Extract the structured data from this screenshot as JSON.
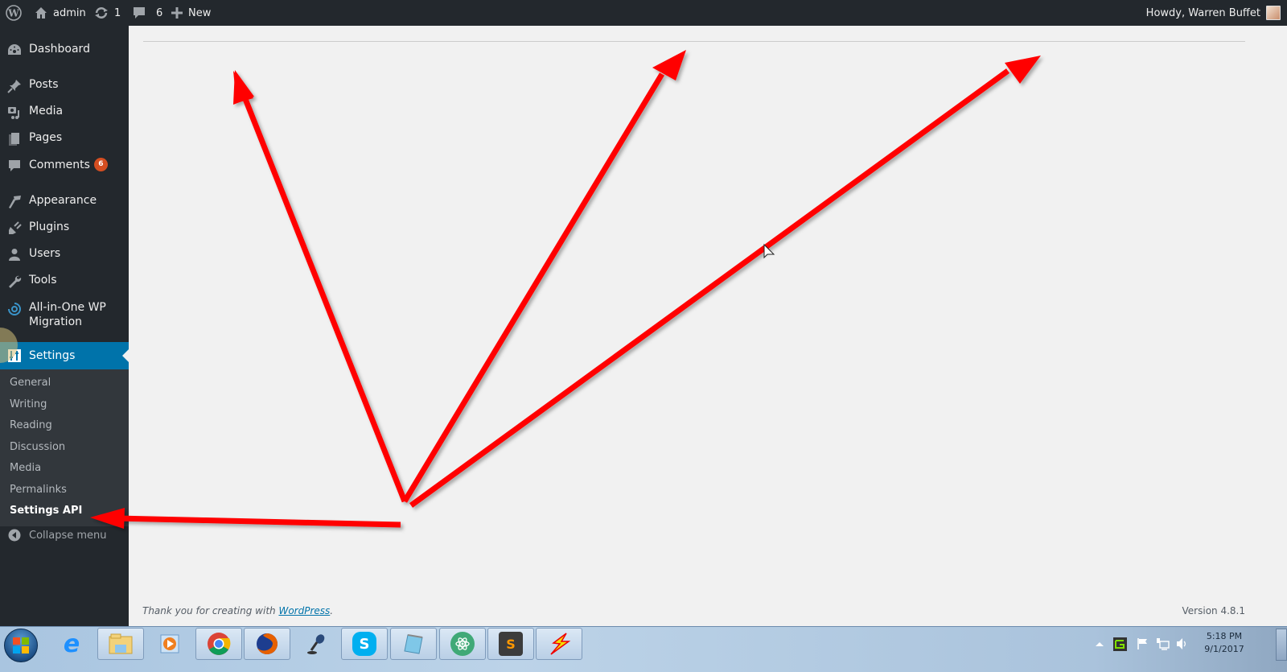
{
  "adminbar": {
    "site_name": "admin",
    "updates_count": "1",
    "comments_count": "6",
    "new_label": "New",
    "greeting": "Howdy, Warren Buffet"
  },
  "sidebar": {
    "items": [
      {
        "label": "Dashboard",
        "icon": "dashboard-icon"
      },
      {
        "label": "Posts",
        "icon": "pin-icon"
      },
      {
        "label": "Media",
        "icon": "media-icon"
      },
      {
        "label": "Pages",
        "icon": "pages-icon"
      },
      {
        "label": "Comments",
        "icon": "comment-icon",
        "badge": "6"
      },
      {
        "label": "Appearance",
        "icon": "paintbrush-icon"
      },
      {
        "label": "Plugins",
        "icon": "plugin-icon"
      },
      {
        "label": "Users",
        "icon": "user-icon"
      },
      {
        "label": "Tools",
        "icon": "wrench-icon"
      },
      {
        "label": "All-in-One WP Migration",
        "icon": "migration-icon"
      },
      {
        "label": "Settings",
        "icon": "settings-icon",
        "current": true
      }
    ],
    "submenu": [
      "General",
      "Writing",
      "Reading",
      "Discussion",
      "Media",
      "Permalinks",
      "Settings API"
    ],
    "submenu_current": "Settings API",
    "collapse_label": "Collapse menu"
  },
  "footer": {
    "thanks_prefix": "Thank you for creating with ",
    "thanks_link": "WordPress",
    "thanks_suffix": ".",
    "version": "Version 4.8.1"
  },
  "annotation": {
    "arrow_color": "#ff0000",
    "arrow_count": 4
  },
  "taskbar": {
    "apps": [
      "Start",
      "Internet Explorer",
      "Windows Explorer",
      "Windows Media Player",
      "Google Chrome",
      "Mozilla Firefox",
      "Microphone",
      "Skype",
      "Notepad",
      "Atom",
      "Sublime Text",
      "FileZilla-like lightning app"
    ],
    "clock_time": "5:18 PM",
    "clock_date": "9/1/2017"
  },
  "colors": {
    "adminbar_bg": "#23282d",
    "accent": "#0073aa",
    "badge": "#d54e21",
    "content_bg": "#f1f1f1"
  }
}
